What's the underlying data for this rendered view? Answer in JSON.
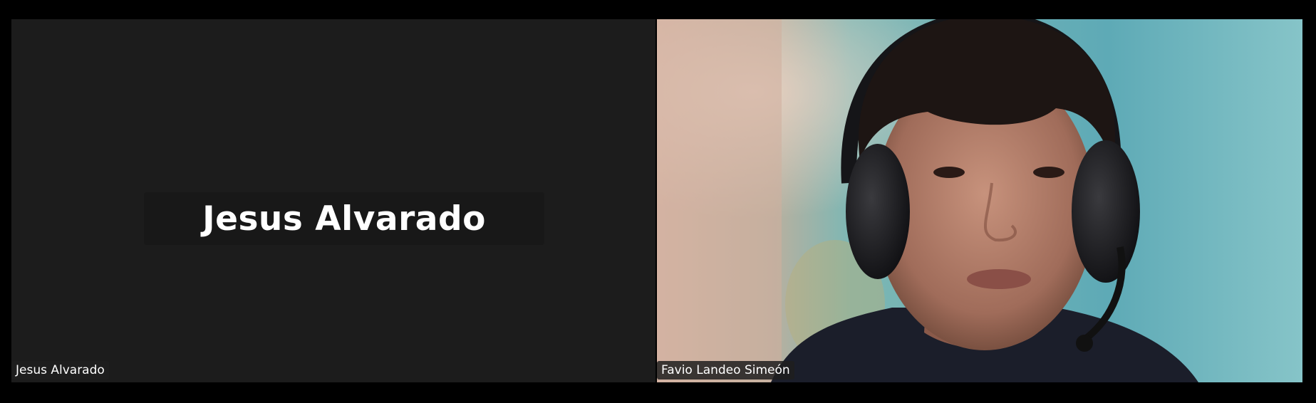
{
  "participants": [
    {
      "name": "Jesus Alvarado",
      "video_on": false,
      "center_label": "Jesus Alvarado"
    },
    {
      "name": "Favio Landeo Simeón",
      "video_on": true
    }
  ],
  "colors": {
    "background": "#000000",
    "tile_off_video": "#1c1c1c",
    "name_plate": "#181818",
    "text": "#ffffff"
  }
}
